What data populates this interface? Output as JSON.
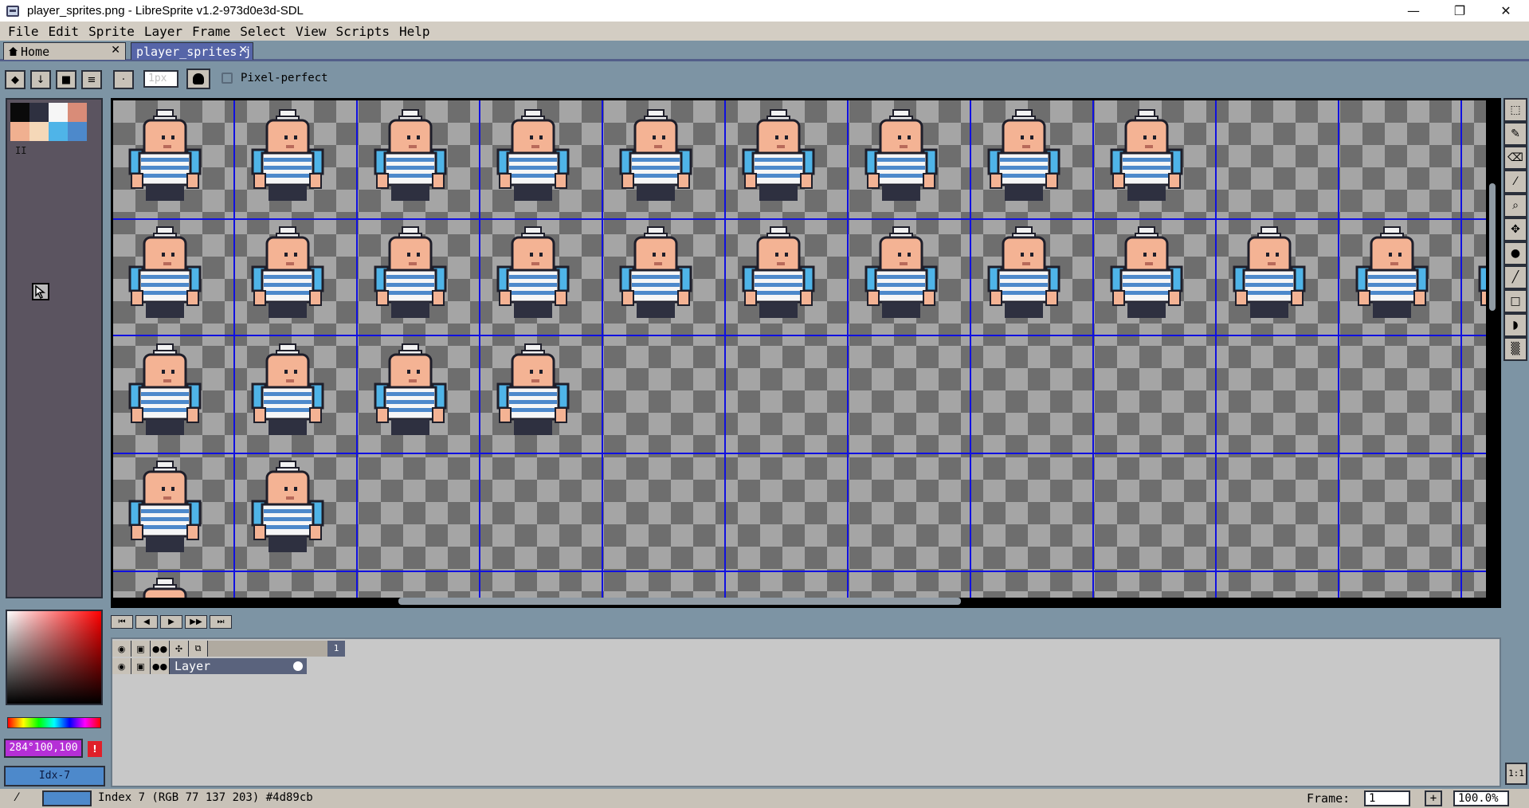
{
  "window": {
    "title": "player_sprites.png - LibreSprite v1.2-973d0e3d-SDL",
    "minimize": "—",
    "maximize": "❐",
    "close": "✕"
  },
  "menu": {
    "items": [
      "File",
      "Edit",
      "Sprite",
      "Layer",
      "Frame",
      "Select",
      "View",
      "Scripts",
      "Help"
    ]
  },
  "tabs": [
    {
      "label": "Home",
      "close": "✕"
    },
    {
      "label": "player_sprites.j",
      "close": "✕"
    }
  ],
  "context_bar": {
    "brush_size_placeholder": "1px",
    "pixel_perfect_label": "Pixel-perfect"
  },
  "palette": {
    "colors": [
      "#0a0a0a",
      "#2e3040",
      "#f6f6f6",
      "#d98c78",
      "#f0b090",
      "#f5d8b8",
      "#4fb4e8",
      "#4d89cb"
    ],
    "marker": "II"
  },
  "tools": [
    "rectangular-marquee",
    "pencil",
    "eraser",
    "eyedropper",
    "zoom",
    "move",
    "paint-bucket",
    "line",
    "rectangle",
    "contour",
    "blur"
  ],
  "color_picker": {
    "hsv_value": "284°100,100",
    "warning": "!",
    "index_label": "Idx-7"
  },
  "timeline": {
    "layer_name": "Layer",
    "frame_number": "1",
    "buttons": [
      "⏮",
      "◀",
      "▶",
      "▶▶",
      "⏭"
    ]
  },
  "status": {
    "text": "Index 7 (RGB 77 137 203) #4d89cb",
    "frame_label": "Frame:",
    "frame_value": "1",
    "add_frame": "+",
    "zoom": "100.0%",
    "zoom_1to1": "1:1"
  },
  "accent_colors": {
    "selected": "#4d89cb",
    "tab_active": "#5665a8",
    "grid": "#1010e0"
  }
}
